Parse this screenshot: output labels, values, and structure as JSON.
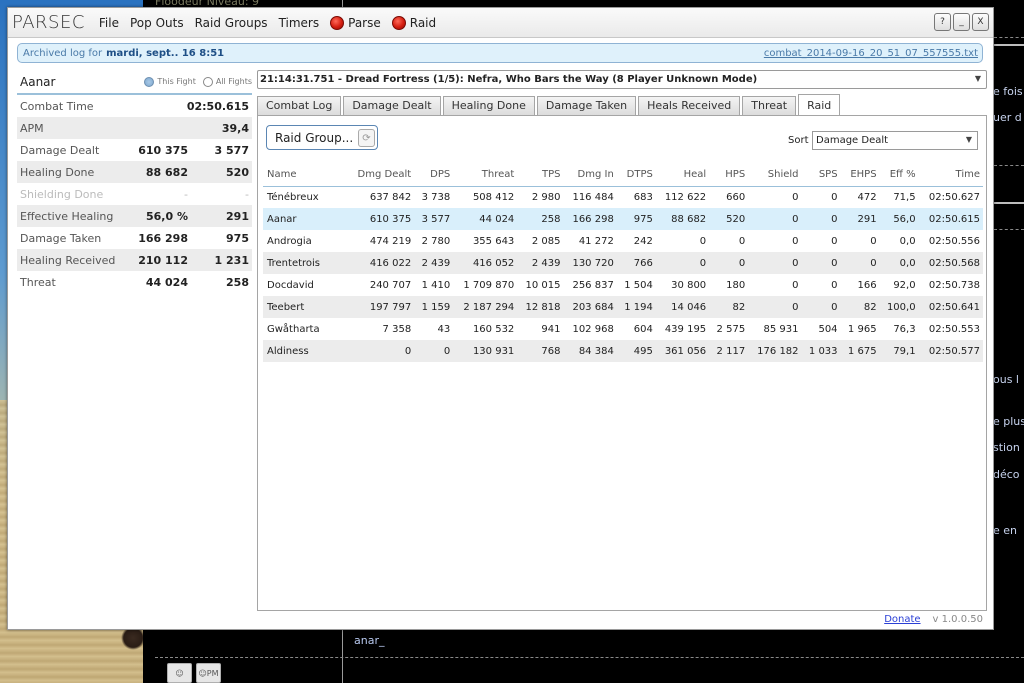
{
  "background": {
    "top_text": "Floodeur Niveau: 9",
    "right_text": [
      "e fois",
      "uer d",
      "ous l",
      "e plus",
      "stion",
      "déco",
      "e en"
    ],
    "chat_name": "anar_",
    "buttons": [
      {
        "icon": "person-icon",
        "label": ""
      },
      {
        "icon": "person-pm-icon",
        "label": "PM"
      }
    ]
  },
  "window": {
    "title": "PARSEC",
    "menu": [
      {
        "label": "File"
      },
      {
        "label": "Pop Outs"
      },
      {
        "label": "Raid Groups"
      },
      {
        "label": "Timers"
      },
      {
        "label": "Parse",
        "icon": "record-icon"
      },
      {
        "label": "Raid",
        "icon": "record-icon"
      }
    ],
    "controls": {
      "help": "?",
      "minimize": "_",
      "close": "X"
    }
  },
  "archive": {
    "prefix": "Archived log for",
    "date": "mardi, sept.. 16 8:51",
    "file": "combat_2014-09-16_20_51_07_557555.txt"
  },
  "stats": {
    "player": "Aanar",
    "scope_options": [
      {
        "label": "This Fight",
        "checked": true
      },
      {
        "label": "All Fights",
        "checked": false
      }
    ],
    "rows": [
      {
        "label": "Combat Time",
        "total": "",
        "rate": "02:50.615",
        "dim": false
      },
      {
        "label": "APM",
        "total": "",
        "rate": "39,4",
        "dim": false
      },
      {
        "label": "Damage Dealt",
        "total": "610 375",
        "rate": "3 577",
        "dim": false
      },
      {
        "label": "Healing Done",
        "total": "88 682",
        "rate": "520",
        "dim": false
      },
      {
        "label": "Shielding Done",
        "total": "-",
        "rate": "-",
        "dim": true
      },
      {
        "label": "Effective Healing",
        "total": "56,0 %",
        "rate": "291",
        "dim": false
      },
      {
        "label": "Damage Taken",
        "total": "166 298",
        "rate": "975",
        "dim": false
      },
      {
        "label": "Healing Received",
        "total": "210 112",
        "rate": "1 231",
        "dim": false
      },
      {
        "label": "Threat",
        "total": "44 024",
        "rate": "258",
        "dim": false
      }
    ]
  },
  "encounter": {
    "selected": "21:14:31.751 - Dread Fortress (1/5): Nefra, Who Bars the Way (8 Player Unknown Mode)"
  },
  "tabs": [
    {
      "label": "Combat Log",
      "active": false
    },
    {
      "label": "Damage Dealt",
      "active": false
    },
    {
      "label": "Healing Done",
      "active": false
    },
    {
      "label": "Damage Taken",
      "active": false
    },
    {
      "label": "Heals Received",
      "active": false
    },
    {
      "label": "Threat",
      "active": false
    },
    {
      "label": "Raid",
      "active": true
    }
  ],
  "raid": {
    "group_button": "Raid Group...",
    "sort_label": "Sort",
    "sort_value": "Damage Dealt",
    "columns": [
      "Name",
      "Dmg Dealt",
      "DPS",
      "Threat",
      "TPS",
      "Dmg In",
      "DTPS",
      "Heal",
      "HPS",
      "Shield",
      "SPS",
      "EHPS",
      "Eff %",
      "Time"
    ],
    "rows": [
      [
        "Ténébreux",
        "637 842",
        "3 738",
        "508 412",
        "2 980",
        "116 484",
        "683",
        "112 622",
        "660",
        "0",
        "0",
        "472",
        "71,5",
        "02:50.627"
      ],
      [
        "Aanar",
        "610 375",
        "3 577",
        "44 024",
        "258",
        "166 298",
        "975",
        "88 682",
        "520",
        "0",
        "0",
        "291",
        "56,0",
        "02:50.615"
      ],
      [
        "Androgia",
        "474 219",
        "2 780",
        "355 643",
        "2 085",
        "41 272",
        "242",
        "0",
        "0",
        "0",
        "0",
        "0",
        "0,0",
        "02:50.556"
      ],
      [
        "Trentetrois",
        "416 022",
        "2 439",
        "416 052",
        "2 439",
        "130 720",
        "766",
        "0",
        "0",
        "0",
        "0",
        "0",
        "0,0",
        "02:50.568"
      ],
      [
        "Docdavid",
        "240 707",
        "1 410",
        "1 709 870",
        "10 015",
        "256 837",
        "1 504",
        "30 800",
        "180",
        "0",
        "0",
        "166",
        "92,0",
        "02:50.738"
      ],
      [
        "Teebert",
        "197 797",
        "1 159",
        "2 187 294",
        "12 818",
        "203 684",
        "1 194",
        "14 046",
        "82",
        "0",
        "0",
        "82",
        "100,0",
        "02:50.641"
      ],
      [
        "Gwåtharta",
        "7 358",
        "43",
        "160 532",
        "941",
        "102 968",
        "604",
        "439 195",
        "2 575",
        "85 931",
        "504",
        "1 965",
        "76,3",
        "02:50.553"
      ],
      [
        "Aldiness",
        "0",
        "0",
        "130 931",
        "768",
        "84 384",
        "495",
        "361 056",
        "2 117",
        "176 182",
        "1 033",
        "1 675",
        "79,1",
        "02:50.577"
      ]
    ],
    "selected_row": 1
  },
  "footer": {
    "donate": "Donate",
    "version": "v 1.0.0.50"
  }
}
